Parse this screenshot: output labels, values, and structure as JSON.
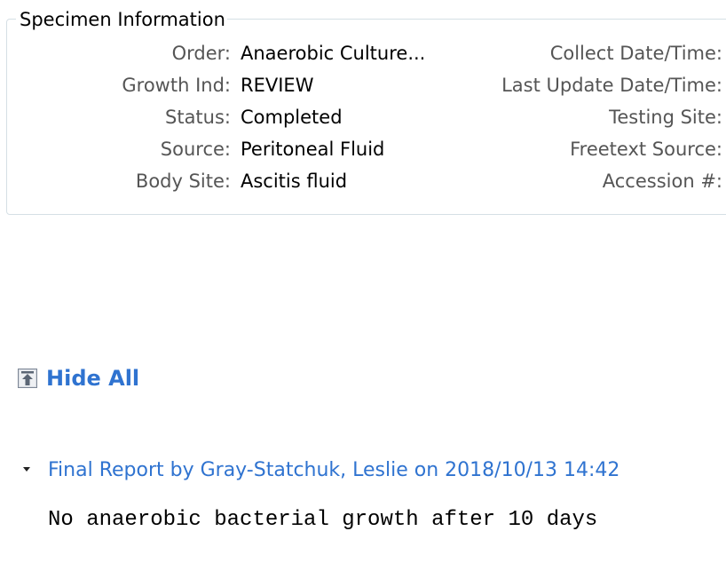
{
  "specimen": {
    "title": "Specimen Information",
    "fields": [
      {
        "label": "Order:",
        "value": "Anaerobic Culture..."
      },
      {
        "label": "Growth Ind:",
        "value": "REVIEW"
      },
      {
        "label": "Status:",
        "value": "Completed"
      },
      {
        "label": "Source:",
        "value": "Peritoneal Fluid"
      },
      {
        "label": "Body Site:",
        "value": "Ascitis fluid"
      }
    ],
    "right_labels": [
      "Collect Date/Time:",
      "Last Update Date/Time:",
      "Testing Site:",
      "Freetext Source:",
      "Accession #:"
    ]
  },
  "controls": {
    "hide_all_label": "Hide All",
    "hide_all_icon": "collapse-up-arrow-icon"
  },
  "report": {
    "title": "Final Report by Gray-Statchuk, Leslie on 2018/10/13 14:42",
    "expander_icon": "triangle-down-icon",
    "body": "No anaerobic bacterial growth after 10 days"
  },
  "colors": {
    "link": "#2f73d0",
    "label": "#555555",
    "group_border": "#d5dfe5"
  }
}
